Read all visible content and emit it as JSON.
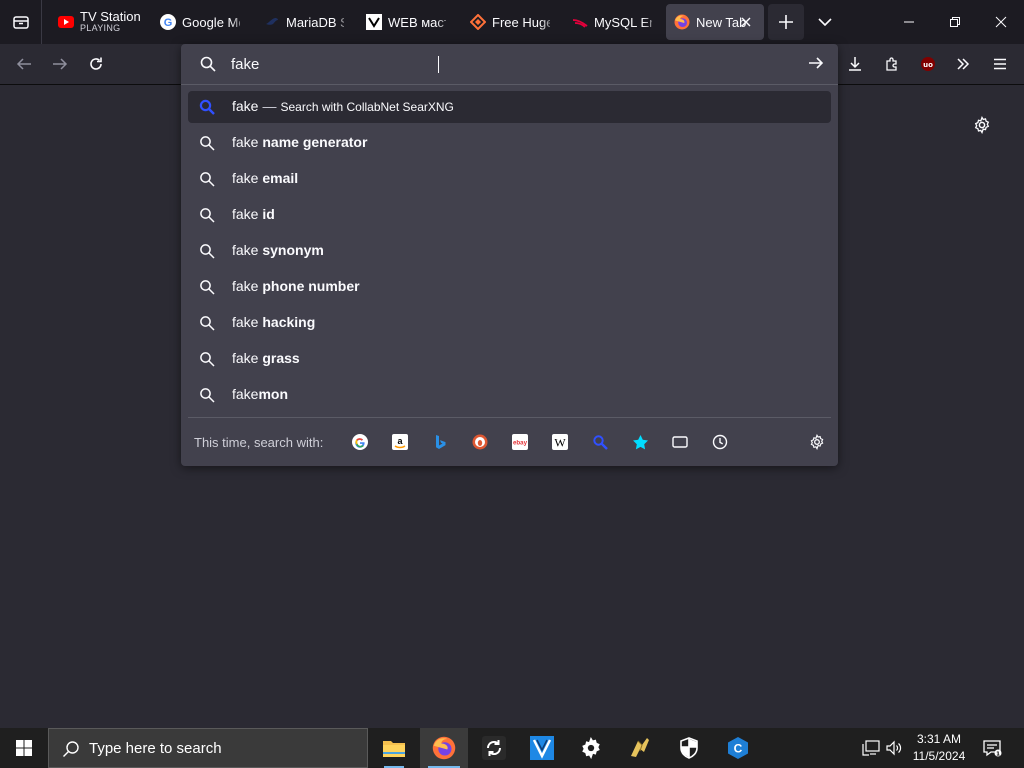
{
  "tabs": [
    {
      "label": "TV Station",
      "sublabel": "PLAYING",
      "icon": "youtube-icon"
    },
    {
      "label": "Google Me",
      "icon": "google-icon"
    },
    {
      "label": "MariaDB S",
      "icon": "mariadb-icon"
    },
    {
      "label": "WEB мастi",
      "icon": "web-icon"
    },
    {
      "label": "Free Huge",
      "icon": "diamond-icon"
    },
    {
      "label": "MySQL Err",
      "icon": "mysql-icon"
    },
    {
      "label": "New Tab",
      "icon": "firefox-icon",
      "active": true
    }
  ],
  "urlbar": {
    "value": "fake",
    "results": [
      {
        "prefix": "fake",
        "bold": "",
        "action": "Search with CollabNet SearXNG",
        "selected": true
      },
      {
        "prefix": "fake ",
        "bold": "name generator"
      },
      {
        "prefix": "fake ",
        "bold": "email"
      },
      {
        "prefix": "fake ",
        "bold": "id"
      },
      {
        "prefix": "fake ",
        "bold": "synonym"
      },
      {
        "prefix": "fake ",
        "bold": "phone number"
      },
      {
        "prefix": "fake ",
        "bold": "hacking"
      },
      {
        "prefix": "fake ",
        "bold": "grass"
      },
      {
        "prefix": "fake",
        "bold": "mon"
      }
    ],
    "oneoff_label": "This time, search with:",
    "dash": "—",
    "engines": [
      "google-icon",
      "amazon-icon",
      "bing-icon",
      "duckduckgo-icon",
      "ebay-icon",
      "wikipedia-icon",
      "searxng-icon",
      "bookmarks-icon",
      "tabs-icon",
      "history-icon"
    ]
  },
  "taskbar": {
    "search_placeholder": "Type here to search",
    "time": "3:31 AM",
    "date": "11/5/2024"
  },
  "colors": {
    "accent_blue": "#0060df",
    "searxng_blue": "#3050ff",
    "taskbar_indicator": "#76b9ed"
  }
}
